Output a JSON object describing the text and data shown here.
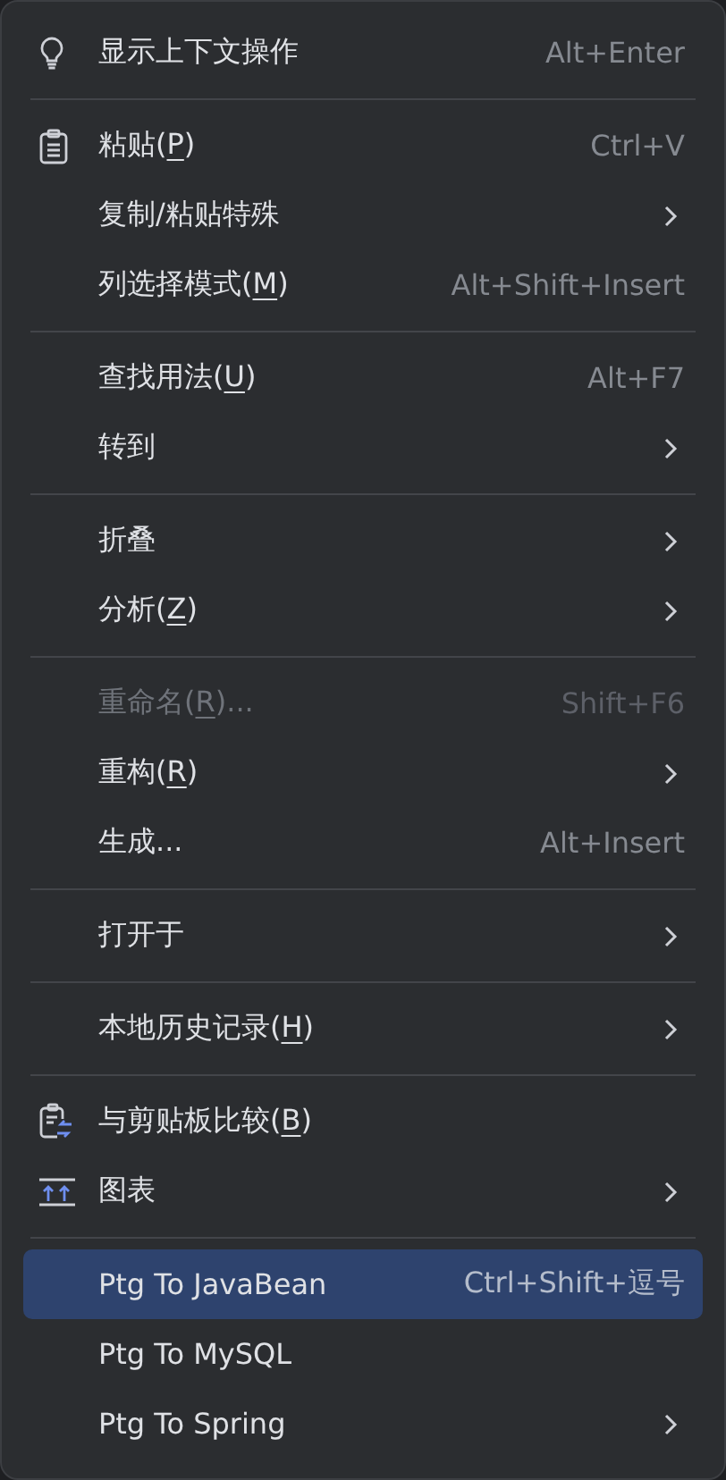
{
  "menu": {
    "groups": [
      {
        "items": [
          {
            "kind": "bulb",
            "label": "显示上下文操作",
            "shortcut": "Alt+Enter",
            "submenu": false,
            "disabled": false,
            "selected": false
          }
        ]
      },
      {
        "items": [
          {
            "kind": "clipboard",
            "label": "粘贴(",
            "mnemonic": "P",
            "label_after": ")",
            "shortcut": "Ctrl+V",
            "submenu": false,
            "disabled": false,
            "selected": false
          },
          {
            "label": "复制/粘贴特殊",
            "submenu": true,
            "disabled": false,
            "selected": false
          },
          {
            "label": "列选择模式(",
            "mnemonic": "M",
            "label_after": ")",
            "shortcut": "Alt+Shift+Insert",
            "submenu": false,
            "disabled": false,
            "selected": false
          }
        ]
      },
      {
        "items": [
          {
            "label": "查找用法(",
            "mnemonic": "U",
            "label_after": ")",
            "shortcut": "Alt+F7",
            "submenu": false,
            "disabled": false,
            "selected": false
          },
          {
            "label": "转到",
            "submenu": true,
            "disabled": false,
            "selected": false
          }
        ]
      },
      {
        "items": [
          {
            "label": "折叠",
            "submenu": true,
            "disabled": false,
            "selected": false
          },
          {
            "label": "分析(",
            "mnemonic": "Z",
            "label_after": ")",
            "submenu": true,
            "disabled": false,
            "selected": false
          }
        ]
      },
      {
        "items": [
          {
            "label": "重命名(",
            "mnemonic": "R",
            "label_after": ")...",
            "shortcut": "Shift+F6",
            "submenu": false,
            "disabled": true,
            "selected": false
          },
          {
            "label": "重构(",
            "mnemonic": "R",
            "label_after": ")",
            "submenu": true,
            "disabled": false,
            "selected": false
          },
          {
            "label": "生成...",
            "shortcut": "Alt+Insert",
            "submenu": false,
            "disabled": false,
            "selected": false
          }
        ]
      },
      {
        "items": [
          {
            "label": "打开于",
            "submenu": true,
            "disabled": false,
            "selected": false
          }
        ]
      },
      {
        "items": [
          {
            "label": "本地历史记录(",
            "mnemonic": "H",
            "label_after": ")",
            "submenu": true,
            "disabled": false,
            "selected": false
          }
        ]
      },
      {
        "items": [
          {
            "kind": "compare",
            "label": "与剪贴板比较(",
            "mnemonic": "B",
            "label_after": ")",
            "submenu": false,
            "disabled": false,
            "selected": false
          },
          {
            "kind": "chart",
            "label": "图表",
            "submenu": true,
            "disabled": false,
            "selected": false
          }
        ]
      },
      {
        "items": [
          {
            "label": "Ptg To JavaBean",
            "shortcut": "Ctrl+Shift+逗号",
            "submenu": false,
            "disabled": false,
            "selected": true
          },
          {
            "label": "Ptg To MySQL",
            "submenu": false,
            "disabled": false,
            "selected": false
          },
          {
            "label": "Ptg To Spring",
            "submenu": true,
            "disabled": false,
            "selected": false
          }
        ]
      }
    ]
  }
}
